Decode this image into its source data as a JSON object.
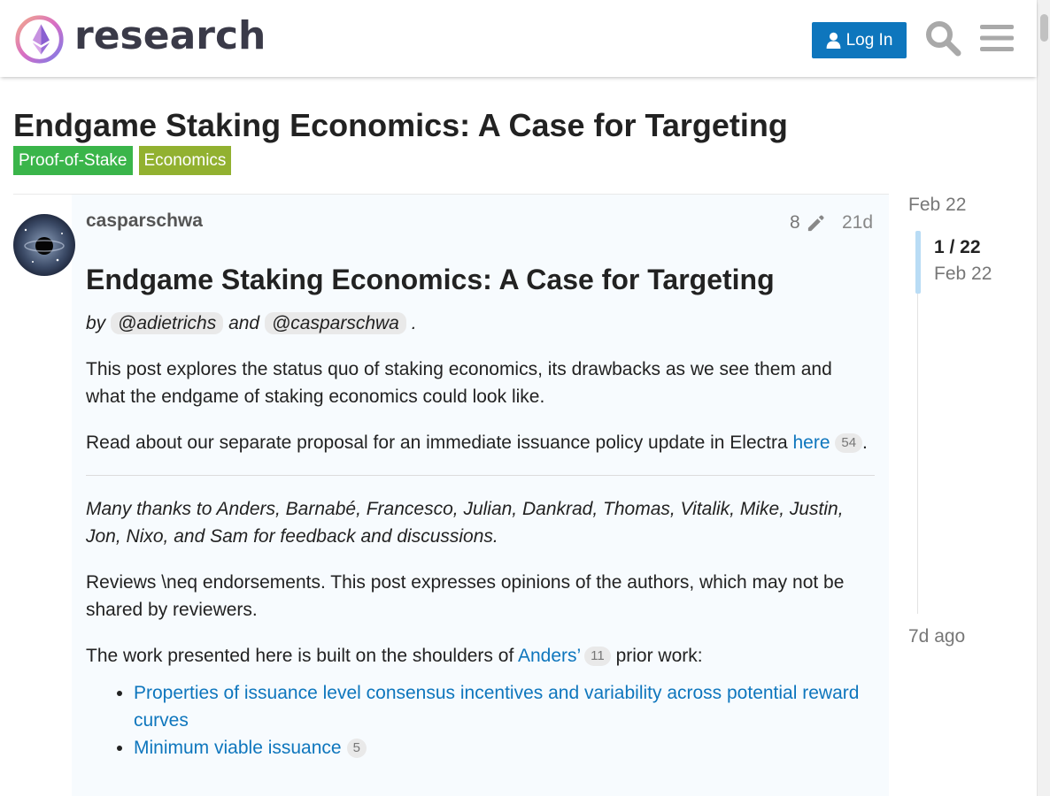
{
  "header": {
    "logo_text": "research",
    "login_label": "Log In"
  },
  "topic": {
    "title": "Endgame Staking Economics: A Case for Targeting",
    "tags": [
      {
        "label": "Proof-of-Stake",
        "color": "#3ab54a"
      },
      {
        "label": "Economics",
        "color": "#92b130"
      }
    ]
  },
  "post": {
    "username": "casparschwa",
    "edit_count": "8",
    "age": "21d",
    "heading": "Endgame Staking Economics: A Case for Targeting",
    "byline": {
      "by": "by",
      "mention1": "@adietrichs",
      "and": "and",
      "mention2": "@casparschwa",
      "end": "."
    },
    "p1": "This post explores the status quo of staking economics, its drawbacks as we see them and what the endgame of staking economics could look like.",
    "p2": {
      "text": "Read about our separate proposal for an immediate issuance policy update in Electra ",
      "link": "here",
      "clicks": "54",
      "end": "."
    },
    "thanks": "Many thanks to Anders, Barnabé, Francesco, Julian, Dankrad, Thomas, Vitalik, Mike, Justin, Jon, Nixo, and Sam for feedback and discussions.",
    "reviews": "Reviews \\neq endorsements. This post expresses opinions of the authors, which may not be shared by reviewers.",
    "shoulders": {
      "text": "The work presented here is built on the shoulders of ",
      "link": "Anders’",
      "clicks": "11",
      "end": " prior work:"
    },
    "list": [
      {
        "link": "Properties of issuance level consensus incentives and variability across potential reward curves",
        "clicks": ""
      },
      {
        "link": "Minimum viable issuance",
        "clicks": "5"
      }
    ]
  },
  "timeline": {
    "start": "Feb 22",
    "position": "1 / 22",
    "position_date": "Feb 22",
    "end": "7d ago"
  },
  "colors": {
    "accent": "#0e76bd",
    "post_bg": "#f7fbfe"
  }
}
